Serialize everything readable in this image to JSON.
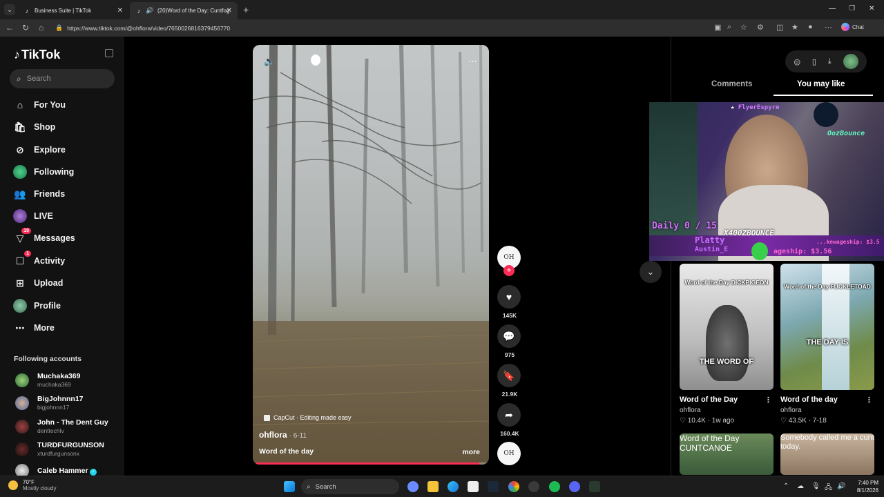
{
  "browser": {
    "tabs": [
      {
        "title": "Business Suite | TikTok"
      },
      {
        "title": "(20)Word of the Day: Cuntfog"
      }
    ],
    "url": "https://www.tiktok.com/@ohflora/video/7650026816379456770",
    "chat_label": "Chat"
  },
  "sidebar": {
    "logo": "TikTok",
    "search_placeholder": "Search",
    "nav": [
      {
        "label": "For You",
        "icon": "home-icon"
      },
      {
        "label": "Shop",
        "icon": "shop-icon"
      },
      {
        "label": "Explore",
        "icon": "compass-icon"
      },
      {
        "label": "Following",
        "icon": "following-icon"
      },
      {
        "label": "Friends",
        "icon": "friends-icon"
      },
      {
        "label": "LIVE",
        "icon": "live-icon"
      },
      {
        "label": "Messages",
        "icon": "messages-icon",
        "badge": "19"
      },
      {
        "label": "Activity",
        "icon": "activity-icon",
        "badge": "1"
      },
      {
        "label": "Upload",
        "icon": "upload-icon"
      },
      {
        "label": "Profile",
        "icon": "profile-icon"
      },
      {
        "label": "More",
        "icon": "more-icon"
      }
    ],
    "following_title": "Following accounts",
    "accounts": [
      {
        "name": "Muchaka369",
        "handle": "muchaka369"
      },
      {
        "name": "BigJohnnn17",
        "handle": "bigjohnnn17"
      },
      {
        "name": "John - The Dent Guy",
        "handle": "denttechlv"
      },
      {
        "name": "TURDFURGUNSON",
        "handle": "xturdfurgunsonx"
      },
      {
        "name": "Caleb Hammer",
        "handle": ""
      }
    ]
  },
  "video": {
    "watermark": "CapCut · Editing made easy",
    "author": "ohflora",
    "date": "· 6-11",
    "description": "Word of the day",
    "more": "more",
    "progress": 0.96
  },
  "actions": {
    "creator_avatar_text": "OH",
    "likes": "145K",
    "comments": "975",
    "saves": "21.9K",
    "shares": "160.4K"
  },
  "panel": {
    "tabs": [
      "Comments",
      "You may like"
    ],
    "stream": {
      "top_name": "FlyerEspyre",
      "daily": "Daily 0 / 15",
      "channel": "X400ZBOUNCE",
      "user1": "Platty",
      "user2": "Austin_E",
      "ticker1": "...kewageship: $3.5",
      "ticker2": "ageship: $3.56",
      "neon": "OozBounce"
    },
    "cards": [
      {
        "title": "Word of the Day",
        "author": "ohflora",
        "likes": "10.4K",
        "age": "1w ago",
        "cap_top": "Word of the Day DICKPIGEON",
        "cap_mid": "THE WORD OF"
      },
      {
        "title": "Word of the day",
        "author": "ohflora",
        "likes": "43.5K",
        "age": "7-18",
        "cap_top": "Word of the Day FUCKLETOAD",
        "cap_mid": "THE DAY IS"
      }
    ],
    "cards_row2": [
      {
        "caption": "Word of the Day CUNTCANOE"
      },
      {
        "caption": "Somebody called me a cunt today."
      }
    ]
  },
  "taskbar": {
    "temp": "70°F",
    "weather": "Mostly cloudy",
    "search": "Search",
    "time": "7:40 PM",
    "date": "8/1/2026"
  },
  "colors": {
    "accent": "#fe2c55",
    "sidebar_bg": "#121212",
    "page_bg": "#000000"
  }
}
